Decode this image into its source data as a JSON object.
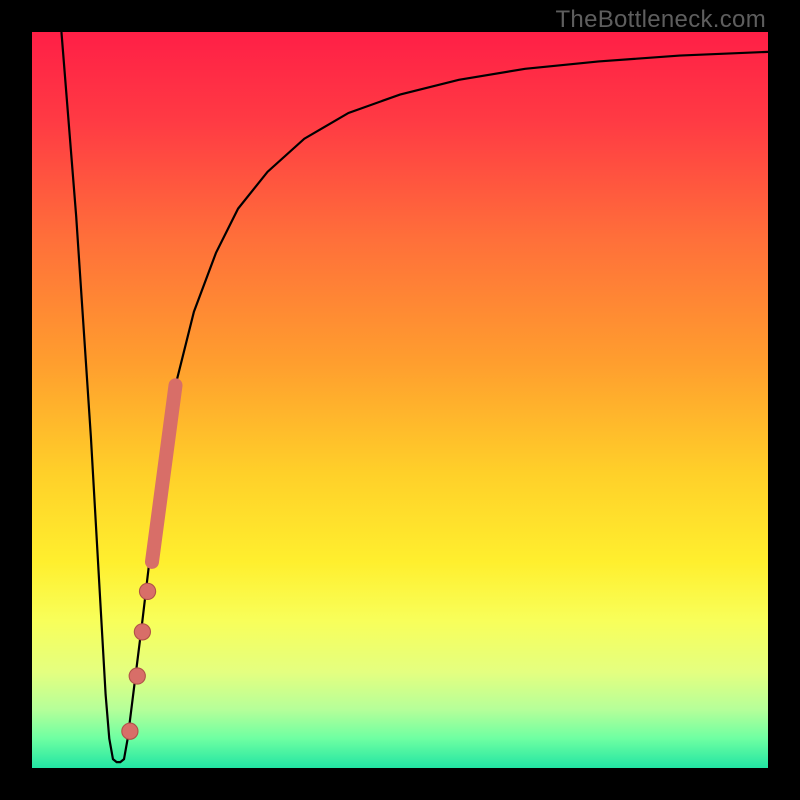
{
  "watermark": "TheBottleneck.com",
  "colors": {
    "frame": "#000000",
    "curve": "#000000",
    "marker_fill": "#d86e68",
    "marker_stroke": "#b15249",
    "gradient_stops": [
      {
        "offset": 0.0,
        "color": "#ff1f46"
      },
      {
        "offset": 0.12,
        "color": "#ff3a44"
      },
      {
        "offset": 0.28,
        "color": "#ff6f3a"
      },
      {
        "offset": 0.45,
        "color": "#ff9e2e"
      },
      {
        "offset": 0.6,
        "color": "#ffd029"
      },
      {
        "offset": 0.72,
        "color": "#ffef2e"
      },
      {
        "offset": 0.8,
        "color": "#f8ff5a"
      },
      {
        "offset": 0.87,
        "color": "#e4ff80"
      },
      {
        "offset": 0.92,
        "color": "#b6ff99"
      },
      {
        "offset": 0.96,
        "color": "#6effa2"
      },
      {
        "offset": 1.0,
        "color": "#22e5a3"
      }
    ]
  },
  "chart_data": {
    "type": "line",
    "title": "",
    "xlabel": "",
    "ylabel": "",
    "xlim": [
      0,
      100
    ],
    "ylim": [
      0,
      100
    ],
    "note": "Axes have no tick labels; values are estimated from pixel positions on a 0–100 grid.",
    "series": [
      {
        "name": "bottleneck-curve",
        "x": [
          4.0,
          6.0,
          8.0,
          10.0,
          10.5,
          11.0,
          11.5,
          12.0,
          12.5,
          13.0,
          13.5,
          14.0,
          15.0,
          17.0,
          19.0,
          22.0,
          25.0,
          28.0,
          32.0,
          37.0,
          43.0,
          50.0,
          58.0,
          67.0,
          77.0,
          88.0,
          100.0
        ],
        "y": [
          100.0,
          75.0,
          45.0,
          10.0,
          4.0,
          1.2,
          0.8,
          0.8,
          1.2,
          4.0,
          8.0,
          12.0,
          20.0,
          37.0,
          50.0,
          62.0,
          70.0,
          76.0,
          81.0,
          85.5,
          89.0,
          91.5,
          93.5,
          95.0,
          96.0,
          96.8,
          97.3
        ]
      }
    ],
    "markers": [
      {
        "x": 13.3,
        "y": 5.0,
        "r": 1.1
      },
      {
        "x": 14.3,
        "y": 12.5,
        "r": 1.1
      },
      {
        "x": 15.0,
        "y": 18.5,
        "r": 1.1
      },
      {
        "x": 15.7,
        "y": 24.0,
        "r": 1.1
      }
    ],
    "marker_bar": {
      "comment": "Short thick coral segment riding the ascending limb",
      "x0": 16.3,
      "y0": 28.0,
      "x1": 19.5,
      "y1": 52.0,
      "width": 2.0
    }
  }
}
